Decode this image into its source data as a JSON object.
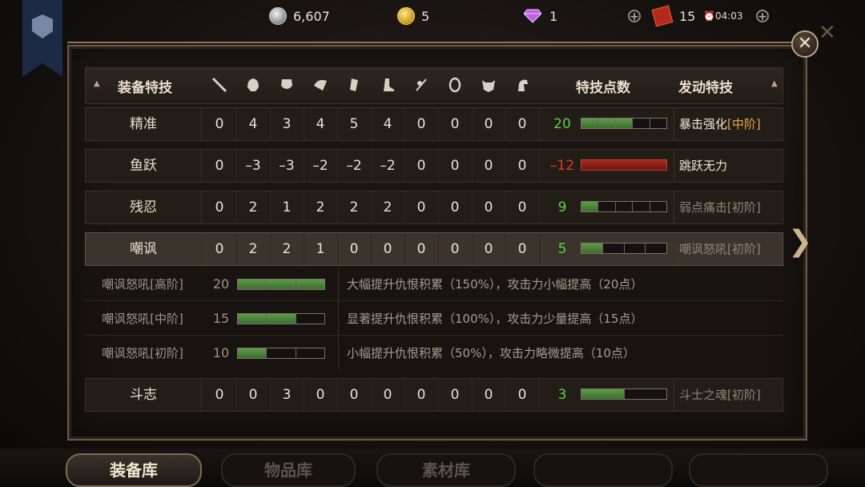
{
  "resources": {
    "silver": "6,607",
    "gold": "5",
    "gems": "1",
    "tickets": "15",
    "timer": "04:03"
  },
  "table": {
    "header": {
      "title": "装备特技",
      "points_label": "特技点数",
      "active_label": "发动特技",
      "slot_icons": [
        "sword-icon",
        "helmet-icon",
        "chest-armor-icon",
        "shoulder-icon",
        "gauntlet-icon",
        "boots-icon",
        "charm-icon",
        "shield-icon",
        "demon-mask-icon",
        "horse-icon"
      ]
    },
    "rows": [
      {
        "name": "精准",
        "values": [
          "0",
          "4",
          "3",
          "4",
          "5",
          "4",
          "0",
          "0",
          "0",
          "0"
        ],
        "points": "20",
        "points_color": "green",
        "bar_fill": 3,
        "bar_segments": 5,
        "effect": "暴击强化",
        "effect_level": "[中阶]",
        "effect_style": "bright"
      },
      {
        "name": "鱼跃",
        "values": [
          "0",
          "–3",
          "–3",
          "–2",
          "–2",
          "–2",
          "0",
          "0",
          "0",
          "0"
        ],
        "points": "–12",
        "points_color": "red",
        "bar_fill": 0,
        "bar_segments": 1,
        "effect": "跳跃无力",
        "effect_level": "",
        "effect_style": "bright"
      },
      {
        "name": "残忍",
        "values": [
          "0",
          "2",
          "1",
          "2",
          "2",
          "2",
          "0",
          "0",
          "0",
          "0"
        ],
        "points": "9",
        "points_color": "green",
        "bar_fill": 1,
        "bar_segments": 5,
        "effect": "弱点痛击[初阶]",
        "effect_level": "",
        "effect_style": "dim"
      },
      {
        "name": "嘲讽",
        "values": [
          "0",
          "2",
          "2",
          "1",
          "0",
          "0",
          "0",
          "0",
          "0",
          "0"
        ],
        "points": "5",
        "points_color": "green",
        "bar_fill": 1,
        "bar_segments": 4,
        "effect": "嘲讽怒吼[初阶]",
        "effect_level": "",
        "effect_style": "dim"
      }
    ],
    "details": [
      {
        "name": "嘲讽怒吼[高阶]",
        "threshold": "20",
        "fill": 3,
        "segments": 3,
        "desc": "大幅提升仇恨积累（150%），攻击力小幅提高（20点）"
      },
      {
        "name": "嘲讽怒吼[中阶]",
        "threshold": "15",
        "fill": 2,
        "segments": 3,
        "desc": "显著提升仇恨积累（100%），攻击力少量提高（15点）"
      },
      {
        "name": "嘲讽怒吼[初阶]",
        "threshold": "10",
        "fill": 1,
        "segments": 3,
        "desc": "小幅提升仇恨积累（50%），攻击力略微提高（10点）"
      }
    ],
    "last_row": {
      "name": "斗志",
      "values": [
        "0",
        "0",
        "3",
        "0",
        "0",
        "0",
        "0",
        "0",
        "0",
        "0"
      ],
      "points": "3",
      "points_color": "green",
      "bar_fill": 1,
      "bar_segments": 2,
      "effect": "斗士之魂[初阶]",
      "effect_style": "dim"
    }
  },
  "tabs": [
    "装备库",
    "物品库",
    "素材库"
  ],
  "colors": {
    "green": "#5ed04a",
    "red": "#e03a2a",
    "level": "#e5a64a"
  }
}
